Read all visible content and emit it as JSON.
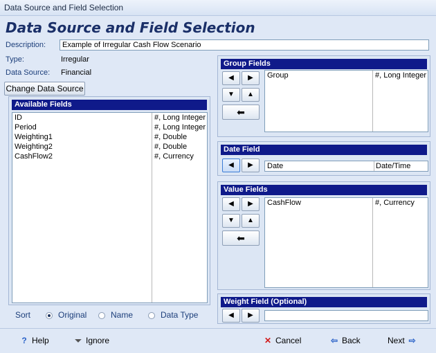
{
  "window": {
    "title": "Data Source and Field Selection"
  },
  "heading": "Data Source and Field Selection",
  "description": {
    "label": "Description:",
    "value": "Example of Irregular Cash Flow Scenario"
  },
  "type": {
    "label": "Type:",
    "value": "Irregular"
  },
  "data_source": {
    "label": "Data Source:",
    "value": "Financial"
  },
  "change_data_source_label": "Change Data Source",
  "available_fields": {
    "title": "Available Fields",
    "items": [
      {
        "name": "ID",
        "type": "#, Long Integer"
      },
      {
        "name": "Period",
        "type": "#, Long Integer"
      },
      {
        "name": "Weighting1",
        "type": "#, Double"
      },
      {
        "name": "Weighting2",
        "type": "#, Double"
      },
      {
        "name": "CashFlow2",
        "type": "#, Currency"
      }
    ]
  },
  "sort": {
    "label": "Sort",
    "options": [
      "Original",
      "Name",
      "Data Type"
    ],
    "selected": "Original"
  },
  "group_fields": {
    "title": "Group Fields",
    "items": [
      {
        "name": "Group",
        "type": "#, Long Integer"
      }
    ]
  },
  "date_field": {
    "title": "Date Field",
    "name": "Date",
    "type": "Date/Time"
  },
  "value_fields": {
    "title": "Value Fields",
    "items": [
      {
        "name": "CashFlow",
        "type": "#, Currency"
      }
    ]
  },
  "weight_field": {
    "title": "Weight Field (Optional)",
    "value": ""
  },
  "footer": {
    "help": "Help",
    "ignore": "Ignore",
    "cancel": "Cancel",
    "back": "Back",
    "next": "Next"
  },
  "colors": {
    "panel_header": "#0f1a8a",
    "label_text": "#1c3e7a",
    "heading": "#1a2f68"
  }
}
